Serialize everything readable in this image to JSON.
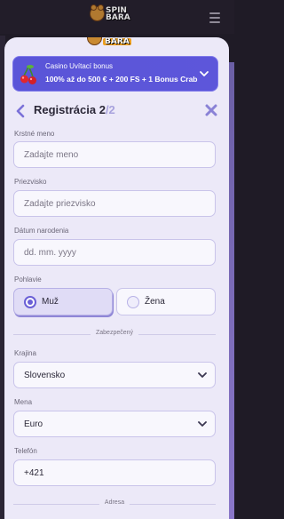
{
  "brand": {
    "line1": "SPIN",
    "line2": "BARA"
  },
  "bonus": {
    "title": "Casino Uvítací bonus",
    "description": "100% až do 500 € + 200 FS + 1 Bonus Crab"
  },
  "step": {
    "title": "Registrácia 2",
    "total": "/2"
  },
  "fields": {
    "first_name": {
      "label": "Krstné meno",
      "placeholder": "Zadajte meno"
    },
    "last_name": {
      "label": "Priezvisko",
      "placeholder": "Zadajte priezvisko"
    },
    "birth_date": {
      "label": "Dátum narodenia",
      "placeholder": "dd. mm. yyyy"
    },
    "gender": {
      "label": "Pohlavie",
      "options": [
        "Muž",
        "Žena"
      ],
      "selected": "Muž"
    },
    "country": {
      "label": "Krajina",
      "value": "Slovensko"
    },
    "currency": {
      "label": "Mena",
      "value": "Euro"
    },
    "phone": {
      "label": "Telefón",
      "value": "+421"
    }
  },
  "dividers": {
    "secured": "Zabezpečený",
    "address": "Adresa"
  },
  "colors": {
    "accent": "#6a5fd6",
    "bonus_bg": "#5a55d8",
    "modal_bg": "#ece9f8",
    "page_bg": "#1f1b26"
  }
}
